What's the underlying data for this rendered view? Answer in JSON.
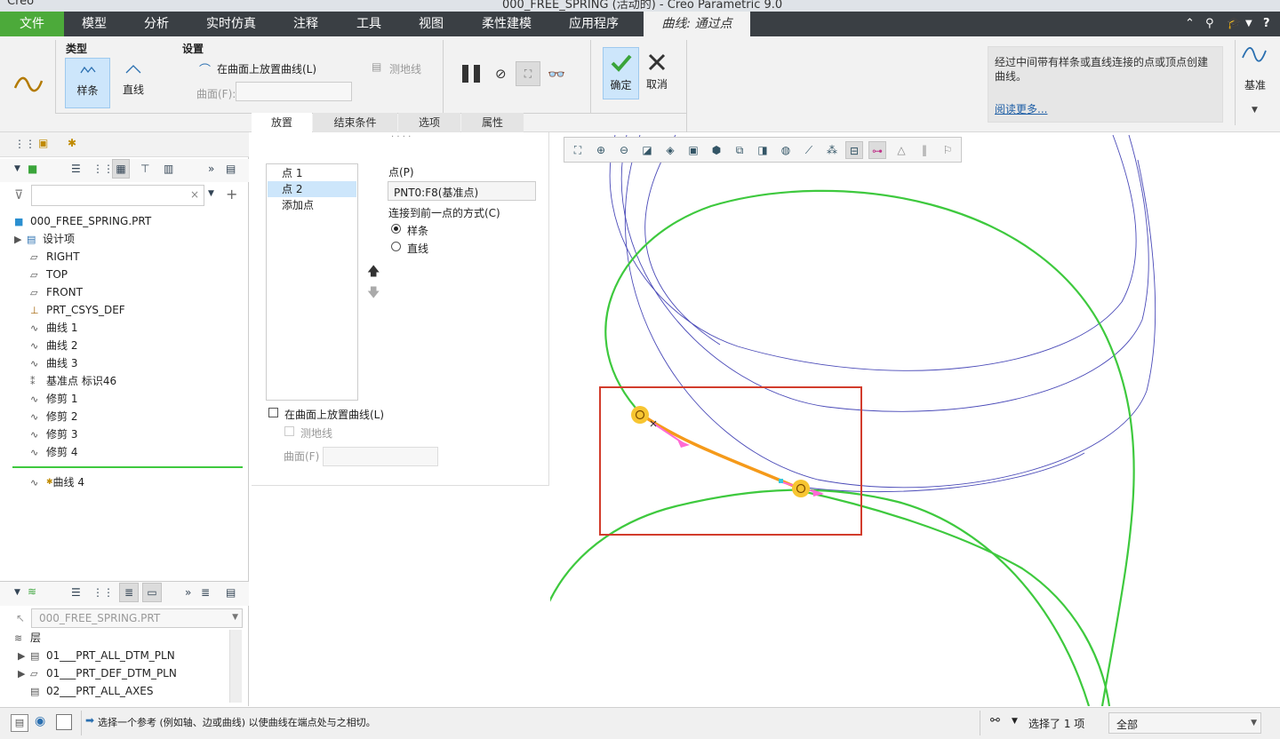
{
  "window": {
    "app_logo": "Creo",
    "title": "000_FREE_SPRING (活动的) - Creo Parametric 9.0"
  },
  "menu": {
    "items": [
      "文件",
      "模型",
      "分析",
      "实时仿真",
      "注释",
      "工具",
      "视图",
      "柔性建模",
      "应用程序",
      "曲线: 通过点"
    ]
  },
  "ribbon": {
    "type_group_label": "类型",
    "type_spline": "样条",
    "type_line": "直线",
    "settings_label": "设置",
    "place_on_surface": "在曲面上放置曲线(L)",
    "geodesic": "测地线",
    "surface_label": "曲面(F):",
    "ok": "确定",
    "cancel": "取消",
    "info_text": "经过中间带有样条或直线连接的点或顶点创建曲线。",
    "read_more": "阅读更多...",
    "datum_label": "基准",
    "subtabs": [
      "放置",
      "结束条件",
      "选项",
      "属性"
    ]
  },
  "tree": {
    "root": "000_FREE_SPRING.PRT",
    "items": [
      {
        "icon": "design-items-icon",
        "label": "设计项",
        "expand": true
      },
      {
        "icon": "datum-plane-icon",
        "label": "RIGHT"
      },
      {
        "icon": "datum-plane-icon",
        "label": "TOP"
      },
      {
        "icon": "datum-plane-icon",
        "label": "FRONT"
      },
      {
        "icon": "csys-icon",
        "label": "PRT_CSYS_DEF"
      },
      {
        "icon": "curve-icon",
        "label": "曲线 1"
      },
      {
        "icon": "curve-icon",
        "label": "曲线 2"
      },
      {
        "icon": "curve-icon",
        "label": "曲线 3"
      },
      {
        "icon": "datum-point-icon",
        "label": "基准点 标识46"
      },
      {
        "icon": "curve-icon",
        "label": "修剪 1"
      },
      {
        "icon": "curve-icon",
        "label": "修剪 2"
      },
      {
        "icon": "curve-icon",
        "label": "修剪 3"
      },
      {
        "icon": "curve-icon",
        "label": "修剪 4"
      }
    ],
    "new_item": "曲线 4"
  },
  "layers": {
    "model_select": "000_FREE_SPRING.PRT",
    "header": "层",
    "items": [
      "01___PRT_ALL_DTM_PLN",
      "01___PRT_DEF_DTM_PLN",
      "02___PRT_ALL_AXES"
    ]
  },
  "dialog": {
    "points": [
      "点 1",
      "点 2",
      "添加点"
    ],
    "selected_index": 1,
    "point_label": "点(P)",
    "point_value": "PNT0:F8(基准点)",
    "connect_label": "连接到前一点的方式(C)",
    "option_spline": "样条",
    "option_line": "直线",
    "place_on_surface": "在曲面上放置曲线(L)",
    "geodesic": "测地线",
    "surface_label": "曲面(F)"
  },
  "status": {
    "message": "选择一个参考 (例如轴、边或曲线) 以使曲线在端点处与之相切。",
    "selected": "选择了 1 项",
    "filter": "全部"
  },
  "colors": {
    "accent_green": "#4caa3a",
    "curve_green": "#3ec93e",
    "helix_blue": "#4a4ab8",
    "highlight_orange": "#f59a1a",
    "frame_red": "#d23c2c",
    "selection_blue": "#cde6fb"
  }
}
